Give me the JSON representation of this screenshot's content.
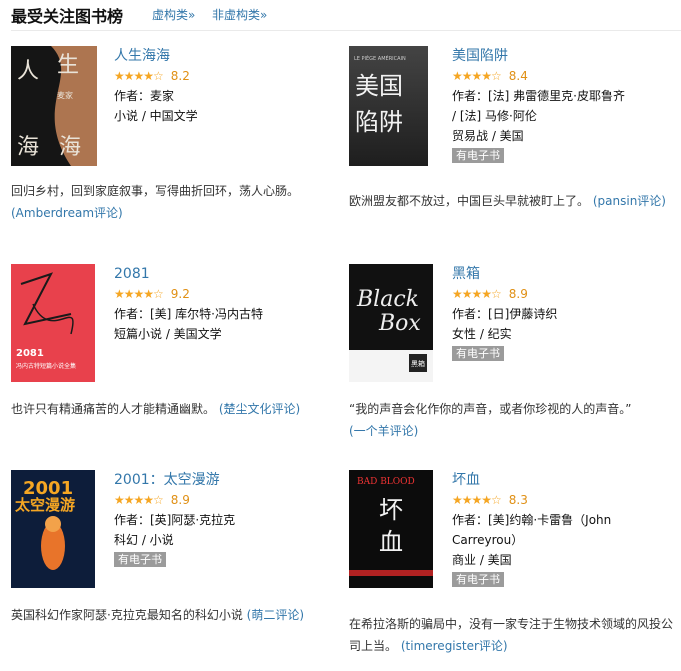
{
  "header": {
    "title": "最受关注图书榜",
    "tabs": [
      "虚构类»",
      "非虚构类»"
    ]
  },
  "books": [
    {
      "title": "人生海海",
      "stars": "★★★★☆",
      "rating": "8.2",
      "author": "作者：麦家",
      "genre": "小说 / 中国文学",
      "badge": "",
      "desc": "回归乡村，回到家庭叙事，写得曲折回环，荡人心肠。",
      "review": "(Amberdream评论)",
      "cover_text": [
        "人",
        "生",
        "海",
        "海",
        "麦家"
      ]
    },
    {
      "title": "美国陷阱",
      "stars": "★★★★☆",
      "rating": "8.4",
      "author": "作者：[法] 弗雷德里克·皮耶鲁齐 / [法] 马修·阿伦",
      "genre": "贸易战 / 美国",
      "badge": "有电子书",
      "desc": "欧洲盟友都不放过，中国巨头早就被盯上了。",
      "review": "(pansin评论)",
      "cover_text": [
        "美国",
        "陷阱",
        "LE PIÈGE AMÉRICAIN"
      ]
    },
    {
      "title": "2081",
      "stars": "★★★★☆",
      "rating": "9.2",
      "author": "作者：[美] 库尔特·冯内古特",
      "genre": "短篇小说 / 美国文学",
      "badge": "",
      "desc": "也许只有精通痛苦的人才能精通幽默。",
      "review": "(楚尘文化评论)",
      "cover_text": [
        "2081",
        "冯内古特短篇小说全集"
      ]
    },
    {
      "title": "黑箱",
      "stars": "★★★★☆",
      "rating": "8.9",
      "author": "作者：[日]伊藤诗织",
      "genre": "女性 / 纪实",
      "badge": "有电子书",
      "desc": "“我的声音会化作你的声音，或者你珍视的人的声音。”",
      "review": "(一个羊评论)",
      "cover_text": [
        "Black",
        "Box",
        "黑箱"
      ]
    },
    {
      "title": "2001：太空漫游",
      "stars": "★★★★☆",
      "rating": "8.9",
      "author": "作者：[英]阿瑟·克拉克",
      "genre": "科幻 / 小说",
      "badge": "有电子书",
      "desc": "英国科幻作家阿瑟·克拉克最知名的科幻小说",
      "review": "(萌二评论)",
      "cover_text": [
        "2001",
        "太空漫游"
      ]
    },
    {
      "title": "坏血",
      "stars": "★★★★☆",
      "rating": "8.3",
      "author": "作者：[美]约翰·卡雷鲁（John Carreyrou）",
      "genre": "商业 / 美国",
      "badge": "有电子书",
      "desc": "在希拉洛斯的骗局中，没有一家专注于生物技术领域的风投公司上当。",
      "review": "(timeregister评论)",
      "cover_text": [
        "BAD BLOOD",
        "坏",
        "血"
      ]
    }
  ]
}
